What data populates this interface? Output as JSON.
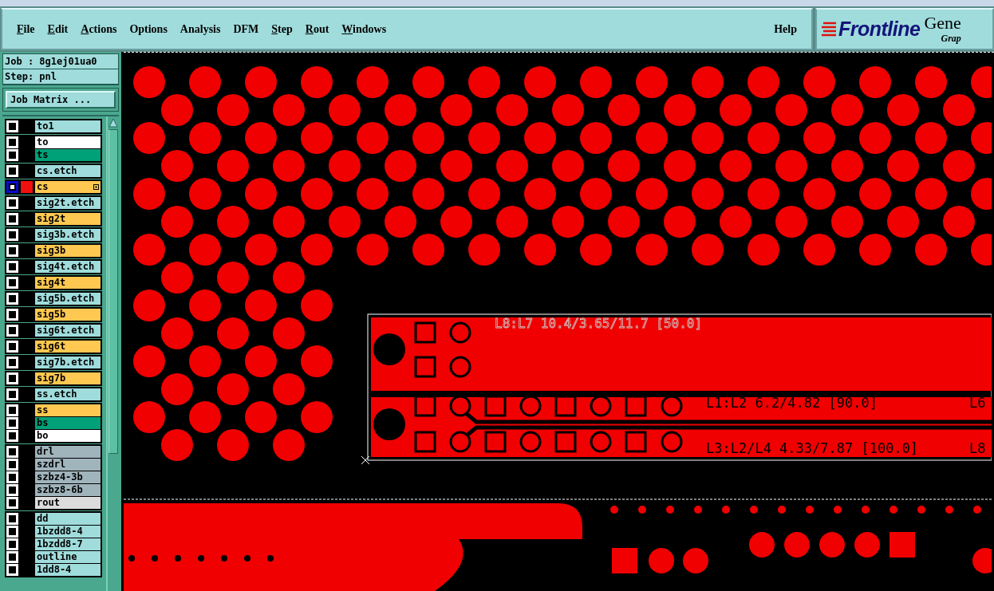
{
  "menu": [
    {
      "label": "File",
      "mnemonic": true
    },
    {
      "label": "Edit",
      "mnemonic": true
    },
    {
      "label": "Actions",
      "mnemonic": true
    },
    {
      "label": "Options",
      "mnemonic": false
    },
    {
      "label": "Analysis",
      "mnemonic": false
    },
    {
      "label": "DFM",
      "mnemonic": false
    },
    {
      "label": "Step",
      "mnemonic": true
    },
    {
      "label": "Rout",
      "mnemonic": true
    },
    {
      "label": "Windows",
      "mnemonic": true
    }
  ],
  "help": "Help",
  "logo": {
    "brand": "Frontline",
    "product": "Gene",
    "subtitle": "Grap"
  },
  "job": "Job : 8g1ej01ua0",
  "step": "Step: pnl",
  "job_matrix_button": "Job Matrix ...",
  "layer_groups": [
    {
      "layers": [
        {
          "name": "to1",
          "color": "#a0dcdc",
          "selected": false,
          "shown": false
        }
      ]
    },
    {
      "layers": [
        {
          "name": "to",
          "color": "#ffffff",
          "selected": false,
          "shown": false
        },
        {
          "name": "ts",
          "color": "#00a078",
          "selected": false,
          "shown": false
        }
      ]
    },
    {
      "layers": [
        {
          "name": "cs.etch",
          "color": "#a0dcdc",
          "selected": false,
          "shown": false
        }
      ]
    },
    {
      "layers": [
        {
          "name": "cs",
          "color": "#ffc850",
          "selected": true,
          "shown": true
        }
      ]
    },
    {
      "layers": [
        {
          "name": "sig2t.etch",
          "color": "#a0dcdc",
          "selected": false,
          "shown": false
        }
      ]
    },
    {
      "layers": [
        {
          "name": "sig2t",
          "color": "#ffc850",
          "selected": false,
          "shown": false
        }
      ]
    },
    {
      "layers": [
        {
          "name": "sig3b.etch",
          "color": "#a0dcdc",
          "selected": false,
          "shown": false
        }
      ]
    },
    {
      "layers": [
        {
          "name": "sig3b",
          "color": "#ffc850",
          "selected": false,
          "shown": false
        }
      ]
    },
    {
      "layers": [
        {
          "name": "sig4t.etch",
          "color": "#a0dcdc",
          "selected": false,
          "shown": false
        }
      ]
    },
    {
      "layers": [
        {
          "name": "sig4t",
          "color": "#ffc850",
          "selected": false,
          "shown": false
        }
      ]
    },
    {
      "layers": [
        {
          "name": "sig5b.etch",
          "color": "#a0dcdc",
          "selected": false,
          "shown": false
        }
      ]
    },
    {
      "layers": [
        {
          "name": "sig5b",
          "color": "#ffc850",
          "selected": false,
          "shown": false
        }
      ]
    },
    {
      "layers": [
        {
          "name": "sig6t.etch",
          "color": "#a0dcdc",
          "selected": false,
          "shown": false
        }
      ]
    },
    {
      "layers": [
        {
          "name": "sig6t",
          "color": "#ffc850",
          "selected": false,
          "shown": false
        }
      ]
    },
    {
      "layers": [
        {
          "name": "sig7b.etch",
          "color": "#a0dcdc",
          "selected": false,
          "shown": false
        }
      ]
    },
    {
      "layers": [
        {
          "name": "sig7b",
          "color": "#ffc850",
          "selected": false,
          "shown": false
        }
      ]
    },
    {
      "layers": [
        {
          "name": "ss.etch",
          "color": "#a0dcdc",
          "selected": false,
          "shown": false
        }
      ]
    },
    {
      "layers": [
        {
          "name": "ss",
          "color": "#ffc850",
          "selected": false,
          "shown": false
        },
        {
          "name": "bs",
          "color": "#00a078",
          "selected": false,
          "shown": false
        },
        {
          "name": "bo",
          "color": "#ffffff",
          "selected": false,
          "shown": false
        }
      ]
    },
    {
      "layers": [
        {
          "name": "drl",
          "color": "#a0b4bc",
          "selected": false,
          "shown": false
        },
        {
          "name": "szdrl",
          "color": "#a0b4bc",
          "selected": false,
          "shown": false
        },
        {
          "name": "szbz4-3b",
          "color": "#a0b4bc",
          "selected": false,
          "shown": false
        },
        {
          "name": "szbz8-6b",
          "color": "#a0b4bc",
          "selected": false,
          "shown": false
        },
        {
          "name": "rout",
          "color": "#dcdcdc",
          "selected": false,
          "shown": false
        }
      ]
    },
    {
      "layers": [
        {
          "name": "dd",
          "color": "#a0dcdc",
          "selected": false,
          "shown": false
        },
        {
          "name": "1bzdd8-4",
          "color": "#a0dcdc",
          "selected": false,
          "shown": false
        },
        {
          "name": "1bzdd8-7",
          "color": "#a0dcdc",
          "selected": false,
          "shown": false
        },
        {
          "name": "outline",
          "color": "#a0dcdc",
          "selected": false,
          "shown": false
        },
        {
          "name": "1dd8-4",
          "color": "#a0dcdc",
          "selected": false,
          "shown": false
        }
      ]
    }
  ],
  "canvas_labels": [
    {
      "text": "L8:L7 10.4/3.65/11.7 [50.0]",
      "kind": "outline"
    },
    {
      "text": "L1:L2 6.2/4.82 [90.0]",
      "kind": "solid"
    },
    {
      "text": "L6",
      "kind": "solid"
    },
    {
      "text": "L3:L2/L4 4.33/7.87 [100.0]",
      "kind": "solid"
    },
    {
      "text": "L8",
      "kind": "solid"
    }
  ]
}
